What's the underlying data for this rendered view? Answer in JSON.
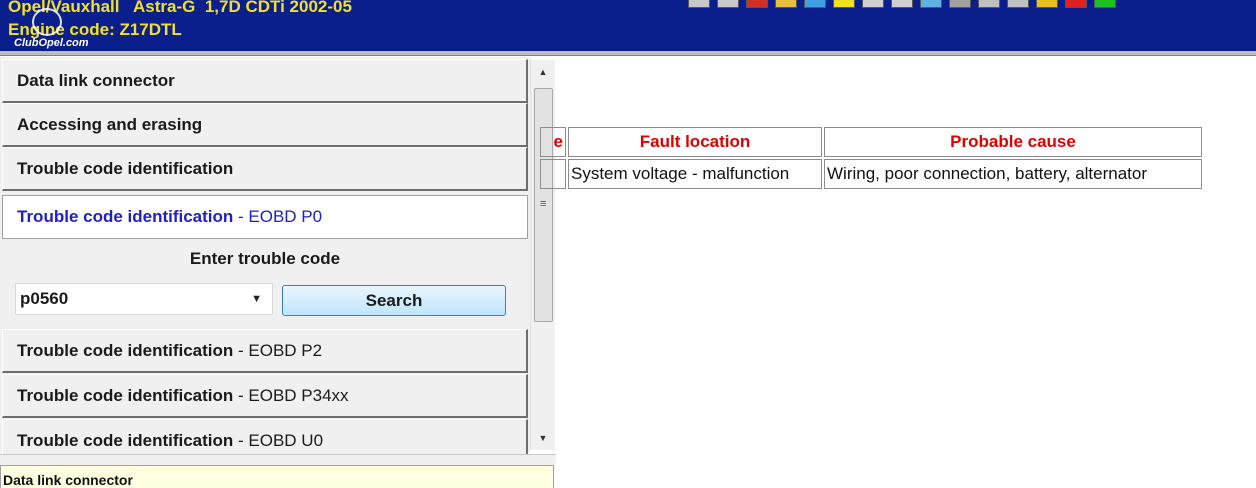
{
  "header": {
    "vehicle": "Opel/Vauxhall   Astra-G  1,7D CDTi 2002-05",
    "engine_code": "Engine code: Z17DTL",
    "watermark": "ClubOpel.com",
    "toolbar_icon_colors": [
      "#c8c8c8",
      "#c8c8c8",
      "#d03020",
      "#e8c040",
      "#40a0e0",
      "#f0e020",
      "#d0d0d0",
      "#d0d0d0",
      "#60b0e0",
      "#a0a0a0",
      "#c0c0c0",
      "#c0c0c0",
      "#e8c020",
      "#e02020",
      "#20c020"
    ]
  },
  "menu": {
    "items": [
      {
        "label": "Data link connector"
      },
      {
        "label": "Accessing and erasing"
      },
      {
        "label": "Trouble code identification"
      },
      {
        "label_bold": "Trouble code identification",
        "label_thin": " - EOBD P0",
        "selected": true
      },
      {
        "label_bold": "Trouble code identification",
        "label_thin": " - EOBD P2"
      },
      {
        "label_bold": "Trouble code identification",
        "label_thin": " - EOBD P34xx"
      },
      {
        "label_bold": "Trouble code identification",
        "label_thin": " - EOBD U0"
      }
    ],
    "search": {
      "title": "Enter trouble code",
      "value": "p0560",
      "button": "Search"
    }
  },
  "table": {
    "headers": [
      "e",
      "Fault location",
      "Probable cause"
    ],
    "rows": [
      [
        "",
        "System voltage - malfunction",
        "Wiring, poor connection, battery, alternator"
      ]
    ]
  },
  "status_bar": {
    "text": "Data link connector"
  }
}
